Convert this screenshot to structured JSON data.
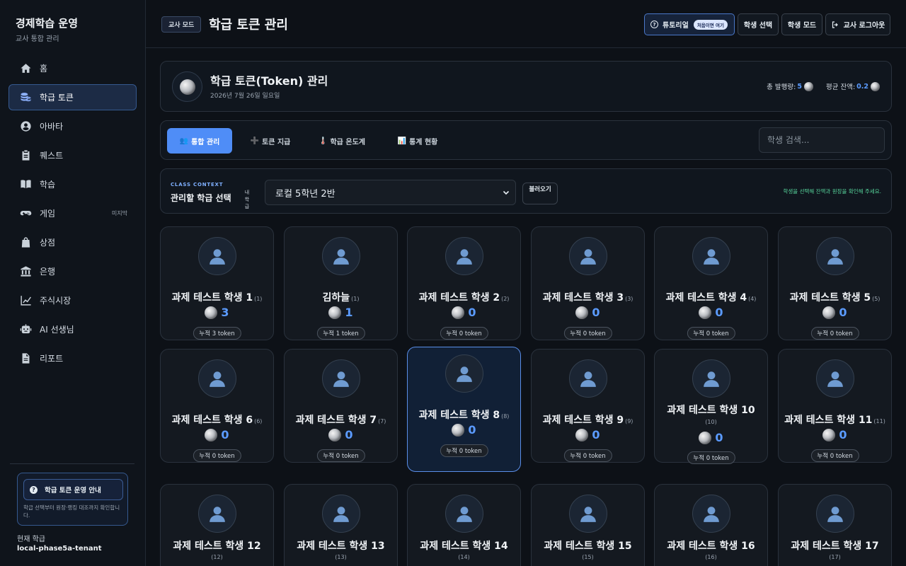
{
  "sidebar": {
    "title": "경제학습 운영",
    "subtitle": "교사 통합 관리",
    "items": [
      {
        "label": "홈",
        "icon": "home-icon"
      },
      {
        "label": "학급 토큰",
        "icon": "coins-icon",
        "active": true
      },
      {
        "label": "아바타",
        "icon": "user-circle-icon"
      },
      {
        "label": "퀘스트",
        "icon": "clipboard-icon"
      },
      {
        "label": "학습",
        "icon": "book-icon"
      },
      {
        "label": "게임",
        "icon": "gamepad-icon",
        "badge": "미지막"
      },
      {
        "label": "상점",
        "icon": "shopping-bag-icon"
      },
      {
        "label": "은행",
        "icon": "bank-icon"
      },
      {
        "label": "주식시장",
        "icon": "chart-line-icon"
      },
      {
        "label": "AI 선생님",
        "icon": "robot-icon"
      },
      {
        "label": "리포트",
        "icon": "file-icon"
      }
    ],
    "guide": {
      "button": "학급 토큰 운영 안내",
      "text": "학급 선택부터 원장·랭킹 대조까지 확인합니다."
    },
    "current_class_label": "현재 학급",
    "current_class_value": "local-phase5a-tenant"
  },
  "header": {
    "mode_badge": "교사 모드",
    "title": "학급 토큰 관리",
    "tutorial_label": "튜토리얼",
    "tutorial_pill": "처음이면 여기",
    "select_student": "학생 선택",
    "student_mode": "학생 모드",
    "logout": "교사 로그아웃"
  },
  "info": {
    "title": "학급 토큰(Token) 관리",
    "date": "2026년 7월 26일 일요일",
    "total_label": "총 발행량:",
    "total_value": "5",
    "avg_label": "평균 잔액:",
    "avg_value": "0.2"
  },
  "tabs": [
    {
      "icon": "👥",
      "label": "통합 관리",
      "active": true
    },
    {
      "icon": "➕",
      "label": "토큰 지급"
    },
    {
      "icon": "🌡️",
      "label": "학급 온도계"
    },
    {
      "icon": "📊",
      "label": "통계 현황"
    }
  ],
  "search": {
    "placeholder": "학생 검색..."
  },
  "context": {
    "eyebrow": "CLASS CONTEXT",
    "title": "관리할 학급 선택",
    "mine": "내 학급",
    "selected": "로컬 5학년 2반",
    "load": "불러오기",
    "hint": "학생을 선택해 잔액과 원장을 확인해 주세요."
  },
  "students": [
    {
      "name": "과제 테스트 학생 1",
      "num": "(1)",
      "tokens": "3",
      "acc": "누적 3 token"
    },
    {
      "name": "김하늘",
      "num": "(1)",
      "tokens": "1",
      "acc": "누적 1 token"
    },
    {
      "name": "과제 테스트 학생 2",
      "num": "(2)",
      "tokens": "0",
      "acc": "누적 0 token"
    },
    {
      "name": "과제 테스트 학생 3",
      "num": "(3)",
      "tokens": "0",
      "acc": "누적 0 token"
    },
    {
      "name": "과제 테스트 학생 4",
      "num": "(4)",
      "tokens": "0",
      "acc": "누적 0 token"
    },
    {
      "name": "과제 테스트 학생 5",
      "num": "(5)",
      "tokens": "0",
      "acc": "누적 0 token"
    },
    {
      "name": "과제 테스트 학생 6",
      "num": "(6)",
      "tokens": "0",
      "acc": "누적 0 token"
    },
    {
      "name": "과제 테스트 학생 7",
      "num": "(7)",
      "tokens": "0",
      "acc": "누적 0 token"
    },
    {
      "name": "과제 테스트 학생 8",
      "num": "(8)",
      "tokens": "0",
      "acc": "누적 0 token"
    },
    {
      "name": "과제 테스트 학생 9",
      "num": "(9)",
      "tokens": "0",
      "acc": "누적 0 token"
    },
    {
      "name": "과제 테스트 학생 10",
      "num": "(10)",
      "tokens": "0",
      "acc": "누적 0 token"
    },
    {
      "name": "과제 테스트 학생 11",
      "num": "(11)",
      "tokens": "0",
      "acc": "누적 0 token"
    },
    {
      "name": "과제 테스트 학생 12",
      "num": "(12)"
    },
    {
      "name": "과제 테스트 학생 13",
      "num": "(13)"
    },
    {
      "name": "과제 테스트 학생 14",
      "num": "(14)"
    },
    {
      "name": "과제 테스트 학생 15",
      "num": "(15)"
    },
    {
      "name": "과제 테스트 학생 16",
      "num": "(16)"
    },
    {
      "name": "과제 테스트 학생 17",
      "num": "(17)"
    }
  ],
  "colors": {
    "accent": "#4f8df7",
    "token_value": "#5b9bff",
    "hint": "#56d39a",
    "bg": "#0d1117"
  }
}
